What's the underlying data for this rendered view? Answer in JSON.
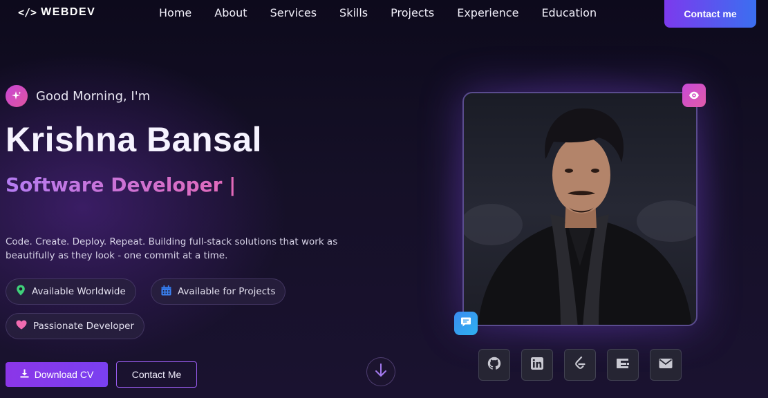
{
  "brand": {
    "icon": "</>",
    "name": "WEBDEV"
  },
  "nav": {
    "links": [
      "Home",
      "About",
      "Services",
      "Skills",
      "Projects",
      "Experience",
      "Education"
    ],
    "contact_label": "Contact me"
  },
  "hero": {
    "greeting": "Good Morning, I'm",
    "name": "Krishna Bansal",
    "role": "Software Developer |",
    "bio": "Code. Create. Deploy. Repeat. Building full-stack solutions that work as beautifully as they look - one commit at a time.",
    "badges": [
      {
        "label": "Available Worldwide",
        "icon": "location-pin-icon"
      },
      {
        "label": "Available for Projects",
        "icon": "calendar-icon"
      },
      {
        "label": "Passionate Developer",
        "icon": "heart-icon"
      }
    ],
    "download_label": "Download CV",
    "contact_label": "Contact Me"
  },
  "socials": [
    "github-icon",
    "linkedin-icon",
    "leetcode-icon",
    "codechef-icon",
    "email-icon"
  ],
  "colors": {
    "accent_purple": "#8b36e8",
    "accent_blue": "#3b6ff0",
    "accent_pink": "#e05ba8",
    "badge_green": "#3fd07a",
    "badge_blue": "#3b82f6",
    "badge_pink": "#f06bb0"
  }
}
